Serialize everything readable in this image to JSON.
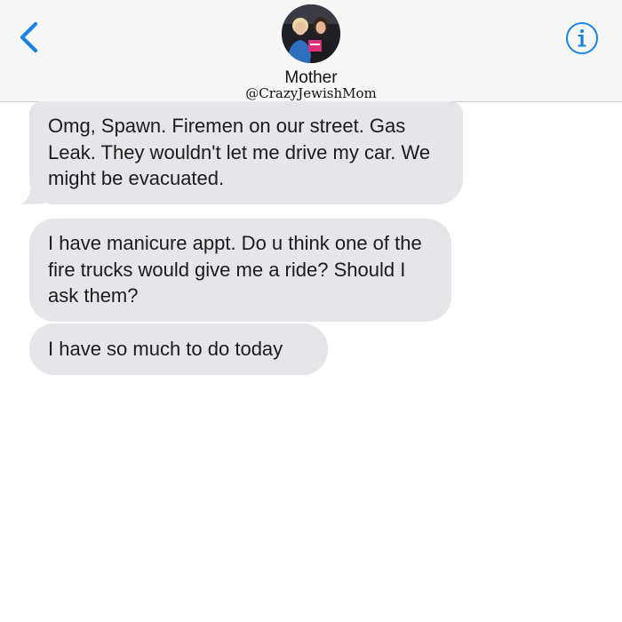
{
  "header": {
    "back_icon": "chevron-left-icon",
    "info_icon": "info-icon",
    "accent_color": "#1a82e2",
    "contact_name": "Mother",
    "contact_handle": "@CrazyJewishMom"
  },
  "messages": [
    {
      "from": "contact",
      "text": "Omg, Spawn. Firemen on our street. Gas Leak. They wouldn't let me drive my car. We might be evacuated."
    },
    {
      "from": "contact",
      "text": "I have manicure appt. Do u think one of the fire trucks would give me a ride? Should I ask them?"
    },
    {
      "from": "contact",
      "text": "I have so much to do today"
    }
  ],
  "colors": {
    "header_bg": "#f7f7f7",
    "bubble_bg": "#e5e5ea",
    "text": "#1c1c1c"
  }
}
